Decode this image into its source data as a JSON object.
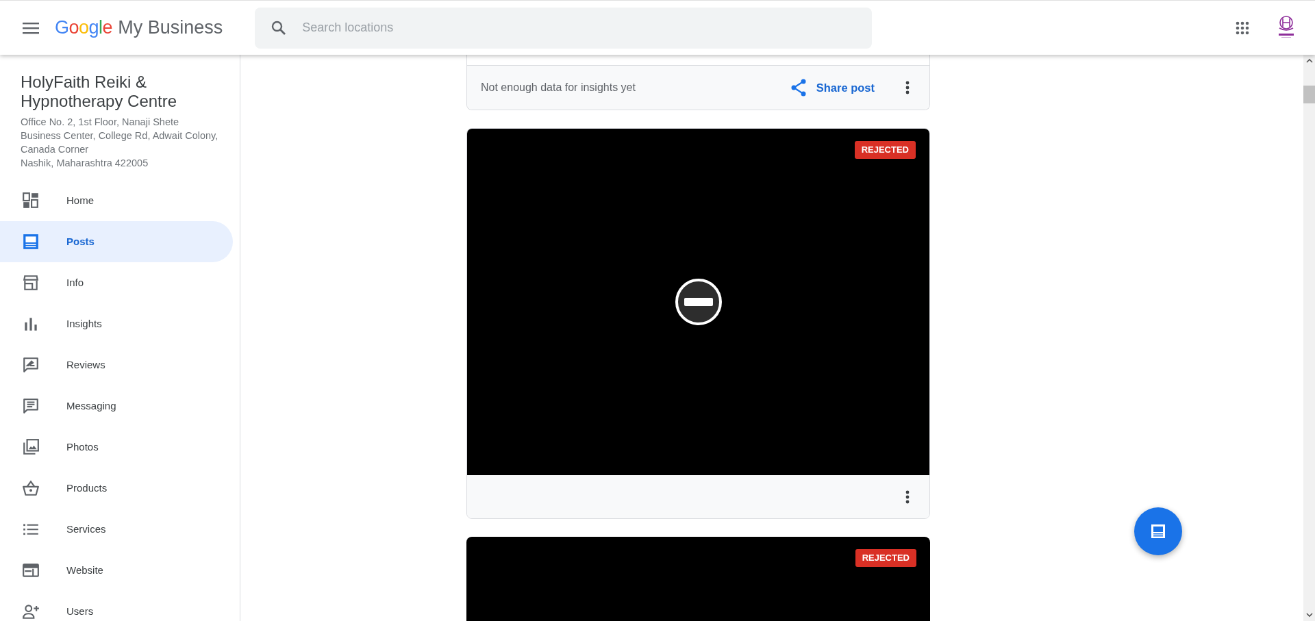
{
  "header": {
    "brand_google": "Google",
    "brand_product": "My Business",
    "search": {
      "placeholder": "Search locations"
    }
  },
  "business": {
    "name": "HolyFaith Reiki & Hypnotherapy Centre",
    "address": [
      "Office No. 2, 1st Floor, Nanaji Shete",
      "Business Center, College Rd, Adwait Colony,",
      "Canada Corner",
      "Nashik, Maharashtra 422005"
    ]
  },
  "sidebar": {
    "items": [
      {
        "label": "Home",
        "selected": false
      },
      {
        "label": "Posts",
        "selected": true
      },
      {
        "label": "Info",
        "selected": false
      },
      {
        "label": "Insights",
        "selected": false
      },
      {
        "label": "Reviews",
        "selected": false
      },
      {
        "label": "Messaging",
        "selected": false
      },
      {
        "label": "Photos",
        "selected": false
      },
      {
        "label": "Products",
        "selected": false
      },
      {
        "label": "Services",
        "selected": false
      },
      {
        "label": "Website",
        "selected": false
      },
      {
        "label": "Users",
        "selected": false
      }
    ]
  },
  "posts": [
    {
      "kind": "insights",
      "insights": "Not enough data for insights yet",
      "share": "Share post"
    },
    {
      "kind": "rejected",
      "badge": "REJECTED"
    },
    {
      "kind": "rejected_partial",
      "badge": "REJECTED"
    }
  ]
}
